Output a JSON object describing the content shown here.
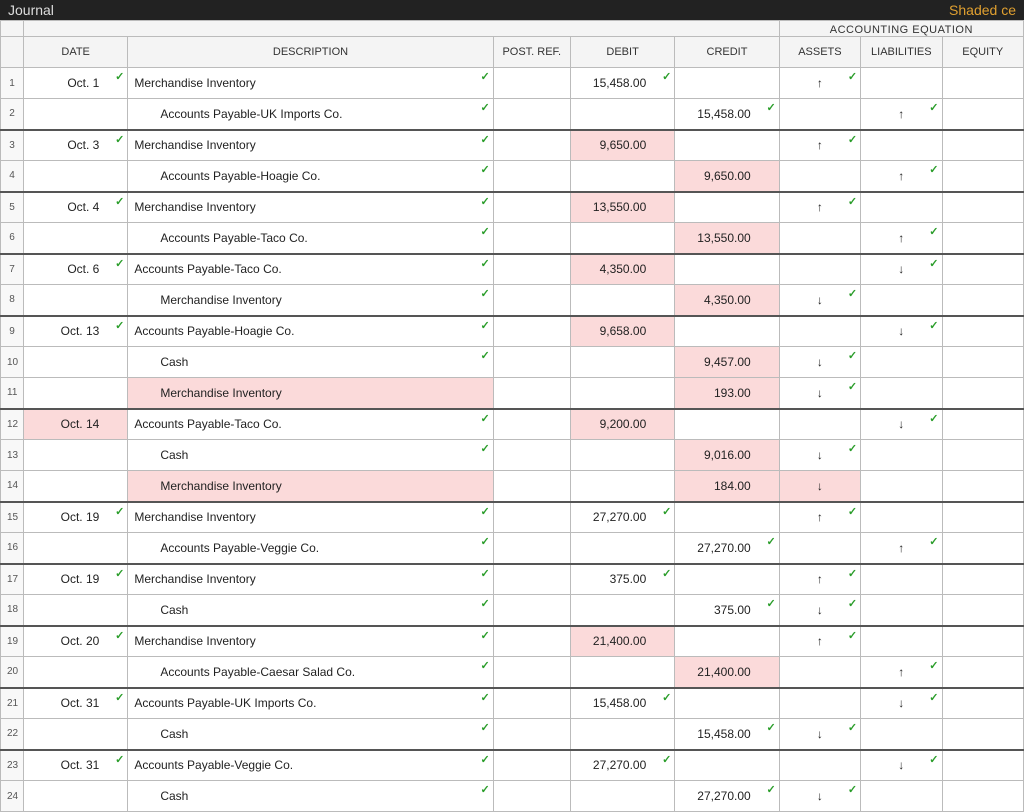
{
  "title_left": "Journal",
  "title_right": "Shaded ce",
  "supertitle": "ACCOUNTING EQUATION",
  "headers": {
    "date": "DATE",
    "description": "DESCRIPTION",
    "postref": "POST. REF.",
    "debit": "DEBIT",
    "credit": "CREDIT",
    "assets": "ASSETS",
    "liabilities": "LIABILITIES",
    "equity": "EQUITY"
  },
  "rows": [
    {
      "n": "1",
      "date": "Oct. 1",
      "date_ck": true,
      "desc": "Merchandise Inventory",
      "indent": false,
      "desc_ck": true,
      "debit": "15,458.00",
      "debit_ck": true,
      "credit": "",
      "assets": "↑",
      "assets_ck": true,
      "liab": "",
      "equity": "",
      "sep": false
    },
    {
      "n": "2",
      "date": "",
      "desc": "Accounts Payable-UK Imports Co.",
      "indent": true,
      "desc_ck": true,
      "debit": "",
      "credit": "15,458.00",
      "credit_ck": true,
      "assets": "",
      "liab": "↑",
      "liab_ck": true,
      "equity": "",
      "sep": false
    },
    {
      "n": "3",
      "date": "Oct. 3",
      "date_ck": true,
      "desc": "Merchandise Inventory",
      "indent": false,
      "desc_ck": true,
      "debit": "9,650.00",
      "debit_sh": true,
      "credit": "",
      "assets": "↑",
      "assets_ck": true,
      "liab": "",
      "equity": "",
      "sep": true
    },
    {
      "n": "4",
      "date": "",
      "desc": "Accounts Payable-Hoagie Co.",
      "indent": true,
      "desc_ck": true,
      "debit": "",
      "credit": "9,650.00",
      "credit_sh": true,
      "assets": "",
      "liab": "↑",
      "liab_ck": true,
      "equity": "",
      "sep": false
    },
    {
      "n": "5",
      "date": "Oct. 4",
      "date_ck": true,
      "desc": "Merchandise Inventory",
      "indent": false,
      "desc_ck": true,
      "debit": "13,550.00",
      "debit_sh": true,
      "credit": "",
      "assets": "↑",
      "assets_ck": true,
      "liab": "",
      "equity": "",
      "sep": true
    },
    {
      "n": "6",
      "date": "",
      "desc": "Accounts Payable-Taco Co.",
      "indent": true,
      "desc_ck": true,
      "debit": "",
      "credit": "13,550.00",
      "credit_sh": true,
      "assets": "",
      "liab": "↑",
      "liab_ck": true,
      "equity": "",
      "sep": false
    },
    {
      "n": "7",
      "date": "Oct. 6",
      "date_ck": true,
      "desc": "Accounts Payable-Taco Co.",
      "indent": false,
      "desc_ck": true,
      "debit": "4,350.00",
      "debit_sh": true,
      "credit": "",
      "assets": "",
      "liab": "↓",
      "liab_ck": true,
      "equity": "",
      "sep": true
    },
    {
      "n": "8",
      "date": "",
      "desc": "Merchandise Inventory",
      "indent": true,
      "desc_ck": true,
      "debit": "",
      "credit": "4,350.00",
      "credit_sh": true,
      "assets": "↓",
      "assets_ck": true,
      "liab": "",
      "equity": "",
      "sep": false
    },
    {
      "n": "9",
      "date": "Oct. 13",
      "date_ck": true,
      "desc": "Accounts Payable-Hoagie Co.",
      "indent": false,
      "desc_ck": true,
      "debit": "9,658.00",
      "debit_sh": true,
      "credit": "",
      "assets": "",
      "liab": "↓",
      "liab_ck": true,
      "equity": "",
      "sep": true
    },
    {
      "n": "10",
      "date": "",
      "desc": "Cash",
      "indent": true,
      "desc_ck": true,
      "debit": "",
      "credit": "9,457.00",
      "credit_sh": true,
      "assets": "↓",
      "assets_ck": true,
      "liab": "",
      "equity": "",
      "sep": false
    },
    {
      "n": "11",
      "date": "",
      "desc": "Merchandise Inventory",
      "indent": true,
      "desc_sh": true,
      "debit": "",
      "credit": "193.00",
      "credit_sh": true,
      "assets": "↓",
      "assets_ck": true,
      "liab": "",
      "equity": "",
      "sep": false
    },
    {
      "n": "12",
      "date": "Oct. 14",
      "date_sh": true,
      "desc": "Accounts Payable-Taco Co.",
      "indent": false,
      "desc_ck": true,
      "debit": "9,200.00",
      "debit_sh": true,
      "credit": "",
      "assets": "",
      "liab": "↓",
      "liab_ck": true,
      "equity": "",
      "sep": true
    },
    {
      "n": "13",
      "date": "",
      "desc": "Cash",
      "indent": true,
      "desc_ck": true,
      "debit": "",
      "credit": "9,016.00",
      "credit_sh": true,
      "assets": "↓",
      "assets_ck": true,
      "liab": "",
      "equity": "",
      "sep": false
    },
    {
      "n": "14",
      "date": "",
      "desc": "Merchandise Inventory",
      "indent": true,
      "desc_sh": true,
      "debit": "",
      "credit": "184.00",
      "credit_sh": true,
      "assets": "↓",
      "assets_sh": true,
      "liab": "",
      "equity": "",
      "sep": false
    },
    {
      "n": "15",
      "date": "Oct. 19",
      "date_ck": true,
      "desc": "Merchandise Inventory",
      "indent": false,
      "desc_ck": true,
      "debit": "27,270.00",
      "debit_ck": true,
      "credit": "",
      "assets": "↑",
      "assets_ck": true,
      "liab": "",
      "equity": "",
      "sep": true
    },
    {
      "n": "16",
      "date": "",
      "desc": "Accounts Payable-Veggie Co.",
      "indent": true,
      "desc_ck": true,
      "debit": "",
      "credit": "27,270.00",
      "credit_ck": true,
      "assets": "",
      "liab": "↑",
      "liab_ck": true,
      "equity": "",
      "sep": false
    },
    {
      "n": "17",
      "date": "Oct. 19",
      "date_ck": true,
      "desc": "Merchandise Inventory",
      "indent": false,
      "desc_ck": true,
      "debit": "375.00",
      "debit_ck": true,
      "credit": "",
      "assets": "↑",
      "assets_ck": true,
      "liab": "",
      "equity": "",
      "sep": true
    },
    {
      "n": "18",
      "date": "",
      "desc": "Cash",
      "indent": true,
      "desc_ck": true,
      "debit": "",
      "credit": "375.00",
      "credit_ck": true,
      "assets": "↓",
      "assets_ck": true,
      "liab": "",
      "equity": "",
      "sep": false
    },
    {
      "n": "19",
      "date": "Oct. 20",
      "date_ck": true,
      "desc": "Merchandise Inventory",
      "indent": false,
      "desc_ck": true,
      "debit": "21,400.00",
      "debit_sh": true,
      "credit": "",
      "assets": "↑",
      "assets_ck": true,
      "liab": "",
      "equity": "",
      "sep": true
    },
    {
      "n": "20",
      "date": "",
      "desc": "Accounts Payable-Caesar Salad Co.",
      "indent": true,
      "desc_ck": true,
      "debit": "",
      "credit": "21,400.00",
      "credit_sh": true,
      "assets": "",
      "liab": "↑",
      "liab_ck": true,
      "equity": "",
      "sep": false
    },
    {
      "n": "21",
      "date": "Oct. 31",
      "date_ck": true,
      "desc": "Accounts Payable-UK Imports Co.",
      "indent": false,
      "desc_ck": true,
      "debit": "15,458.00",
      "debit_ck": true,
      "credit": "",
      "assets": "",
      "liab": "↓",
      "liab_ck": true,
      "equity": "",
      "sep": true
    },
    {
      "n": "22",
      "date": "",
      "desc": "Cash",
      "indent": true,
      "desc_ck": true,
      "debit": "",
      "credit": "15,458.00",
      "credit_ck": true,
      "assets": "↓",
      "assets_ck": true,
      "liab": "",
      "equity": "",
      "sep": false
    },
    {
      "n": "23",
      "date": "Oct. 31",
      "date_ck": true,
      "desc": "Accounts Payable-Veggie Co.",
      "indent": false,
      "desc_ck": true,
      "debit": "27,270.00",
      "debit_ck": true,
      "credit": "",
      "assets": "",
      "liab": "↓",
      "liab_ck": true,
      "equity": "",
      "sep": true
    },
    {
      "n": "24",
      "date": "",
      "desc": "Cash",
      "indent": true,
      "desc_ck": true,
      "debit": "",
      "credit": "27,270.00",
      "credit_ck": true,
      "assets": "↓",
      "assets_ck": true,
      "liab": "",
      "equity": "",
      "sep": false
    }
  ]
}
